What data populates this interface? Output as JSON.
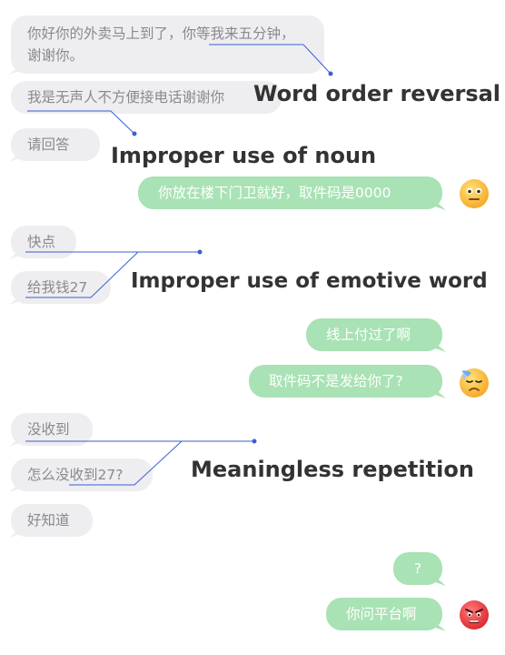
{
  "messages": {
    "m1": "你好你的外卖马上到了，你等我来五分钟，谢谢你。",
    "m2": "我是无声人不方便接电话谢谢你",
    "m3": "请回答",
    "m4": "你放在楼下门卫就好，取件码是0000",
    "m5": "快点",
    "m6": "给我钱27",
    "m7": "线上付过了啊",
    "m8": "取件码不是发给你了?",
    "m9": "没收到",
    "m10": "怎么没收到27?",
    "m11": "好知道",
    "m12": "?",
    "m13": "你问平台啊"
  },
  "annotations": {
    "word_order": "Word order reversal",
    "noun": "Improper use of noun",
    "emotive": "Improper use of emotive word",
    "repetition": "Meaningless repetition"
  },
  "emojis": {
    "e1": "neutral-face-icon",
    "e2": "downcast-sweat-face-icon",
    "e3": "angry-face-icon"
  },
  "colors": {
    "incoming_bubble": "#eeeef1",
    "outgoing_bubble": "#a9e2b4",
    "annotation_line": "#3a5fd0",
    "annotation_text": "#333333"
  }
}
